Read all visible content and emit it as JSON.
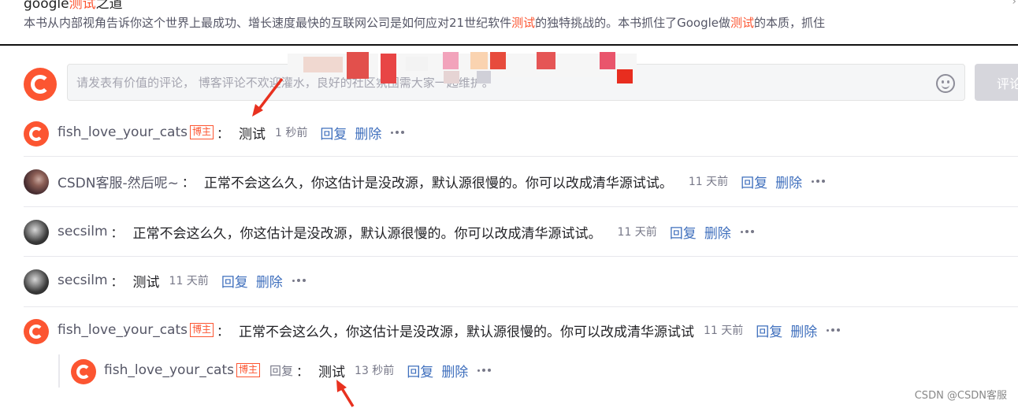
{
  "article": {
    "title_parts": [
      "google",
      "测试",
      "之道"
    ],
    "desc_parts": [
      "本书从内部视角告诉你这个世界上最成功、增长速度最快的互联网公司是如何应对21世纪软件",
      "测试",
      "的独特挑战的。本书抓住了Google做",
      "测试",
      "的本质，抓住"
    ],
    "corner_mark": "›"
  },
  "comment_box": {
    "placeholder": "请发表有价值的评论， 博客评论不欢迎灌水，良好的社区氛围需大家一起维护。",
    "submit_label": "评论",
    "emoji_icon": "smile-icon"
  },
  "colors": {
    "accent": "#fc5531",
    "link": "#3f6fbd",
    "muted": "#777888"
  },
  "comments": [
    {
      "user": "fish_love_your_cats",
      "badge": "博主",
      "text": "测试",
      "time": "1 秒前",
      "reply": "回复",
      "delete": "删除"
    },
    {
      "user": "CSDN客服-然后呢~",
      "text": "正常不会这么久，你这估计是没改源，默认源很慢的。你可以改成清华源试试。",
      "time": "11 天前",
      "reply": "回复",
      "delete": "删除"
    },
    {
      "user": "secsilm",
      "text": "正常不会这么久，你这估计是没改源，默认源很慢的。你可以改成清华源试试。",
      "time": "11 天前",
      "reply": "回复",
      "delete": "删除"
    },
    {
      "user": "secsilm",
      "text": "测试",
      "time": "11 天前",
      "reply": "回复",
      "delete": "删除"
    },
    {
      "user": "fish_love_your_cats",
      "badge": "博主",
      "text": "正常不会这么久，你这估计是没改源，默认源很慢的。你可以改成清华源试试",
      "time": "11 天前",
      "reply": "回复",
      "delete": "删除"
    }
  ],
  "reply": {
    "user": "fish_love_your_cats",
    "badge": "博主",
    "reply_word": "回复",
    "text": "测试",
    "time": "13 秒前",
    "reply": "回复",
    "delete": "删除"
  },
  "watermark": "CSDN @CSDN客服"
}
